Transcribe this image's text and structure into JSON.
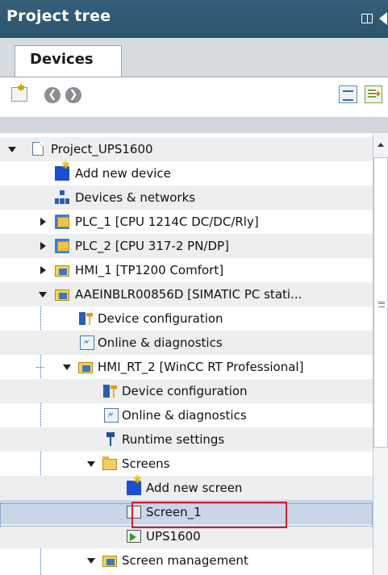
{
  "panel": {
    "title": "Project tree",
    "tab": "Devices"
  },
  "tree": [
    {
      "label": "Project_UPS1600",
      "icon": "project-icon",
      "expander": "expanded"
    },
    {
      "label": "Add new device",
      "icon": "add-device-icon",
      "expander": "none"
    },
    {
      "label": "Devices & networks",
      "icon": "network-icon",
      "expander": "none"
    },
    {
      "label": "PLC_1 [CPU 1214C DC/DC/Rly]",
      "icon": "plc-folder-icon",
      "expander": "collapsed"
    },
    {
      "label": "PLC_2 [CPU 317-2 PN/DP]",
      "icon": "plc-folder-icon",
      "expander": "collapsed"
    },
    {
      "label": "HMI_1 [TP1200 Comfort]",
      "icon": "hmi-folder-icon",
      "expander": "collapsed"
    },
    {
      "label": "AAEINBLR00856D [SIMATIC PC stati...",
      "icon": "pc-station-folder-icon",
      "expander": "expanded"
    },
    {
      "label": "Device configuration",
      "icon": "device-configuration-icon",
      "expander": "none"
    },
    {
      "label": "Online & diagnostics",
      "icon": "online-diagnostics-icon",
      "expander": "none"
    },
    {
      "label": "HMI_RT_2 [WinCC RT Professional]",
      "icon": "hmi-runtime-folder-icon",
      "expander": "expanded"
    },
    {
      "label": "Device configuration",
      "icon": "device-configuration-icon",
      "expander": "none"
    },
    {
      "label": "Online & diagnostics",
      "icon": "online-diagnostics-icon",
      "expander": "none"
    },
    {
      "label": "Runtime settings",
      "icon": "runtime-settings-icon",
      "expander": "none"
    },
    {
      "label": "Screens",
      "icon": "folder-open-icon",
      "expander": "expanded"
    },
    {
      "label": "Add new screen",
      "icon": "add-screen-icon",
      "expander": "none"
    },
    {
      "label": "Screen_1",
      "icon": "screen-icon",
      "expander": "none",
      "selected": true
    },
    {
      "label": "UPS1600",
      "icon": "start-screen-icon",
      "expander": "none"
    },
    {
      "label": "Screen management",
      "icon": "screen-management-folder-icon",
      "expander": "expanded"
    }
  ],
  "colors": {
    "title_bar": "#2f5872",
    "selected_row": "#c8d6e8",
    "highlight_box": "#d0202a"
  }
}
